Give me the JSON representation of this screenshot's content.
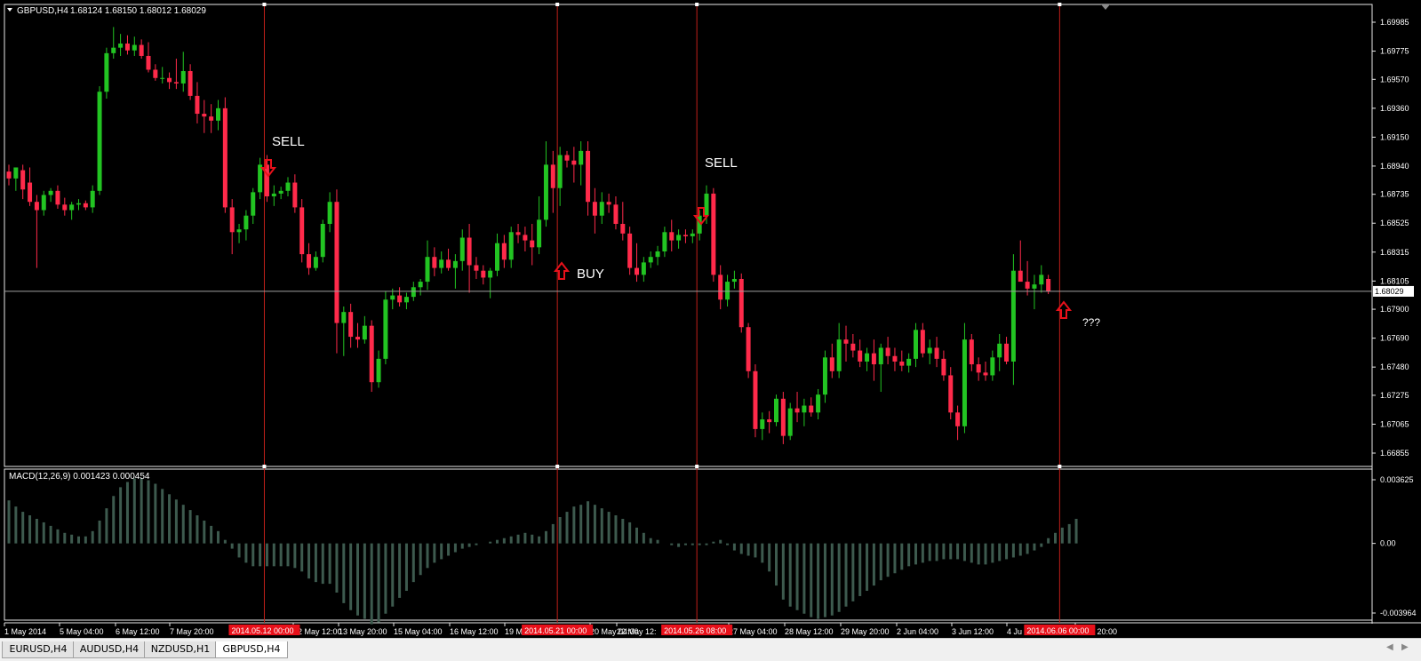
{
  "window": {
    "symbol_label": "GBPUSD,H4",
    "ohlc_text": "1.68124 1.68150 1.68012 1.68029",
    "current_price_label": "1.68029"
  },
  "price_axis_labels": [
    "1.69985",
    "1.69775",
    "1.69570",
    "1.69360",
    "1.69150",
    "1.68940",
    "1.68735",
    "1.68525",
    "1.68315",
    "1.68105",
    "1.67900",
    "1.67690",
    "1.67480",
    "1.67275",
    "1.67065",
    "1.66855"
  ],
  "macd_axis_labels": [
    "0.003625",
    "0.00",
    "-0.003964"
  ],
  "macd_label": "MACD(12,26,9) 0.001423 0.000454",
  "time_axis_labels": [
    "1 May 2014",
    "5 May 04:00",
    "6 May 12:00",
    "7 May 20:00",
    "12 May 12:00",
    "13 May 20:00",
    "15 May 04:00",
    "16 May 12:00",
    "19 M",
    "20 May 04:00",
    "22 May 12:",
    "27 May 04:00",
    "28 May 12:00",
    "29 May 20:00",
    "2 Jun 04:00",
    "3 Jun 12:00",
    "4 Ju",
    "4 Jun 20:00"
  ],
  "markers": [
    {
      "datetime_label": "2014.05.12 00:00",
      "signal": "SELL",
      "direction": "down"
    },
    {
      "datetime_label": "2014.05.21 00:00",
      "signal": "BUY",
      "direction": "up"
    },
    {
      "datetime_label": "2014.05.26 08:00",
      "signal": "SELL",
      "direction": "down"
    },
    {
      "datetime_label": "2014.06.06 00:00",
      "signal": "???",
      "direction": "up"
    }
  ],
  "tabs": [
    {
      "label": "EURUSD,H4",
      "active": false
    },
    {
      "label": "AUDUSD,H4",
      "active": false
    },
    {
      "label": "NZDUSD,H1",
      "active": false
    },
    {
      "label": "GBPUSD,H4",
      "active": true
    }
  ],
  "colors": {
    "bull": "#22c422",
    "bear": "#ff2a4a",
    "marker_line": "#c0201a",
    "grid_text": "#ffffff",
    "macd": "#3d5a4e",
    "bid_line": "#a0a0a0",
    "arrow": "#e8101a"
  },
  "chart_data": {
    "type": "candlestick",
    "symbol": "GBPUSD",
    "timeframe": "H4",
    "price_range": [
      1.66855,
      1.69985
    ],
    "candles": [
      {
        "o": 1.689,
        "h": 1.6895,
        "l": 1.688,
        "c": 1.6885
      },
      {
        "o": 1.6885,
        "h": 1.6892,
        "l": 1.6876,
        "c": 1.6893
      },
      {
        "o": 1.6891,
        "h": 1.6895,
        "l": 1.687,
        "c": 1.6877
      },
      {
        "o": 1.6882,
        "h": 1.6893,
        "l": 1.6865,
        "c": 1.6868
      },
      {
        "o": 1.6868,
        "h": 1.6873,
        "l": 1.682,
        "c": 1.6862
      },
      {
        "o": 1.6862,
        "h": 1.6876,
        "l": 1.6858,
        "c": 1.6873
      },
      {
        "o": 1.6873,
        "h": 1.6878,
        "l": 1.6868,
        "c": 1.6876
      },
      {
        "o": 1.6876,
        "h": 1.688,
        "l": 1.6863,
        "c": 1.6866
      },
      {
        "o": 1.6866,
        "h": 1.6871,
        "l": 1.6858,
        "c": 1.6862
      },
      {
        "o": 1.6862,
        "h": 1.6868,
        "l": 1.6855,
        "c": 1.6866
      },
      {
        "o": 1.6866,
        "h": 1.687,
        "l": 1.6862,
        "c": 1.6867
      },
      {
        "o": 1.6867,
        "h": 1.6869,
        "l": 1.6862,
        "c": 1.6864
      },
      {
        "o": 1.6864,
        "h": 1.688,
        "l": 1.686,
        "c": 1.6876
      },
      {
        "o": 1.6876,
        "h": 1.6952,
        "l": 1.6873,
        "c": 1.6948
      },
      {
        "o": 1.6948,
        "h": 1.698,
        "l": 1.6943,
        "c": 1.6976
      },
      {
        "o": 1.6976,
        "h": 1.6995,
        "l": 1.6972,
        "c": 1.698
      },
      {
        "o": 1.698,
        "h": 1.699,
        "l": 1.6974,
        "c": 1.6983
      },
      {
        "o": 1.6983,
        "h": 1.6989,
        "l": 1.6975,
        "c": 1.6978
      },
      {
        "o": 1.6978,
        "h": 1.6988,
        "l": 1.6974,
        "c": 1.6982
      },
      {
        "o": 1.6982,
        "h": 1.6986,
        "l": 1.6972,
        "c": 1.6974
      },
      {
        "o": 1.6974,
        "h": 1.6984,
        "l": 1.6962,
        "c": 1.6964
      },
      {
        "o": 1.6964,
        "h": 1.6968,
        "l": 1.6956,
        "c": 1.6958
      },
      {
        "o": 1.6958,
        "h": 1.6966,
        "l": 1.6954,
        "c": 1.6958
      },
      {
        "o": 1.6958,
        "h": 1.6962,
        "l": 1.695,
        "c": 1.6955
      },
      {
        "o": 1.6955,
        "h": 1.6972,
        "l": 1.695,
        "c": 1.6954
      },
      {
        "o": 1.6954,
        "h": 1.6977,
        "l": 1.6948,
        "c": 1.6963
      },
      {
        "o": 1.6963,
        "h": 1.6968,
        "l": 1.6942,
        "c": 1.6945
      },
      {
        "o": 1.6945,
        "h": 1.6955,
        "l": 1.6925,
        "c": 1.6932
      },
      {
        "o": 1.6932,
        "h": 1.6942,
        "l": 1.6918,
        "c": 1.693
      },
      {
        "o": 1.693,
        "h": 1.6939,
        "l": 1.6918,
        "c": 1.6927
      },
      {
        "o": 1.6927,
        "h": 1.6942,
        "l": 1.692,
        "c": 1.6936
      },
      {
        "o": 1.6936,
        "h": 1.6944,
        "l": 1.686,
        "c": 1.6864
      },
      {
        "o": 1.6864,
        "h": 1.687,
        "l": 1.683,
        "c": 1.6846
      },
      {
        "o": 1.6846,
        "h": 1.6852,
        "l": 1.6838,
        "c": 1.6848
      },
      {
        "o": 1.6848,
        "h": 1.6862,
        "l": 1.684,
        "c": 1.6858
      },
      {
        "o": 1.6858,
        "h": 1.6878,
        "l": 1.6852,
        "c": 1.6875
      },
      {
        "o": 1.6875,
        "h": 1.69,
        "l": 1.687,
        "c": 1.6895
      },
      {
        "o": 1.6895,
        "h": 1.6902,
        "l": 1.6868,
        "c": 1.6872
      },
      {
        "o": 1.6872,
        "h": 1.688,
        "l": 1.6865,
        "c": 1.6874
      },
      {
        "o": 1.6874,
        "h": 1.6879,
        "l": 1.687,
        "c": 1.6876
      },
      {
        "o": 1.6876,
        "h": 1.6886,
        "l": 1.6872,
        "c": 1.6882
      },
      {
        "o": 1.6882,
        "h": 1.6888,
        "l": 1.686,
        "c": 1.6864
      },
      {
        "o": 1.6864,
        "h": 1.687,
        "l": 1.6824,
        "c": 1.683
      },
      {
        "o": 1.683,
        "h": 1.6838,
        "l": 1.6815,
        "c": 1.682
      },
      {
        "o": 1.682,
        "h": 1.6832,
        "l": 1.6818,
        "c": 1.6828
      },
      {
        "o": 1.6828,
        "h": 1.6855,
        "l": 1.6824,
        "c": 1.6852
      },
      {
        "o": 1.6852,
        "h": 1.6875,
        "l": 1.6846,
        "c": 1.6868
      },
      {
        "o": 1.6868,
        "h": 1.6877,
        "l": 1.6758,
        "c": 1.678
      },
      {
        "o": 1.678,
        "h": 1.6792,
        "l": 1.6756,
        "c": 1.6788
      },
      {
        "o": 1.6788,
        "h": 1.6794,
        "l": 1.6762,
        "c": 1.677
      },
      {
        "o": 1.677,
        "h": 1.678,
        "l": 1.6762,
        "c": 1.6768
      },
      {
        "o": 1.6768,
        "h": 1.6785,
        "l": 1.6765,
        "c": 1.6778
      },
      {
        "o": 1.6778,
        "h": 1.6782,
        "l": 1.673,
        "c": 1.6737
      },
      {
        "o": 1.6737,
        "h": 1.676,
        "l": 1.6733,
        "c": 1.6754
      },
      {
        "o": 1.6754,
        "h": 1.6803,
        "l": 1.675,
        "c": 1.6797
      },
      {
        "o": 1.6797,
        "h": 1.6805,
        "l": 1.679,
        "c": 1.68
      },
      {
        "o": 1.68,
        "h": 1.6806,
        "l": 1.6792,
        "c": 1.6795
      },
      {
        "o": 1.6795,
        "h": 1.6802,
        "l": 1.679,
        "c": 1.6799
      },
      {
        "o": 1.6799,
        "h": 1.681,
        "l": 1.6796,
        "c": 1.6806
      },
      {
        "o": 1.6806,
        "h": 1.6812,
        "l": 1.68,
        "c": 1.681
      },
      {
        "o": 1.681,
        "h": 1.684,
        "l": 1.6804,
        "c": 1.6828
      },
      {
        "o": 1.6828,
        "h": 1.6835,
        "l": 1.6814,
        "c": 1.682
      },
      {
        "o": 1.682,
        "h": 1.6832,
        "l": 1.6816,
        "c": 1.6826
      },
      {
        "o": 1.6826,
        "h": 1.6834,
        "l": 1.6818,
        "c": 1.682
      },
      {
        "o": 1.682,
        "h": 1.683,
        "l": 1.6805,
        "c": 1.6825
      },
      {
        "o": 1.6825,
        "h": 1.6848,
        "l": 1.6818,
        "c": 1.6842
      },
      {
        "o": 1.6842,
        "h": 1.6852,
        "l": 1.6802,
        "c": 1.6822
      },
      {
        "o": 1.6822,
        "h": 1.6828,
        "l": 1.6812,
        "c": 1.6818
      },
      {
        "o": 1.6818,
        "h": 1.6822,
        "l": 1.6808,
        "c": 1.6813
      },
      {
        "o": 1.6813,
        "h": 1.682,
        "l": 1.6798,
        "c": 1.6818
      },
      {
        "o": 1.6818,
        "h": 1.6845,
        "l": 1.6814,
        "c": 1.6838
      },
      {
        "o": 1.6838,
        "h": 1.6844,
        "l": 1.682,
        "c": 1.6826
      },
      {
        "o": 1.6826,
        "h": 1.685,
        "l": 1.682,
        "c": 1.6846
      },
      {
        "o": 1.6846,
        "h": 1.6852,
        "l": 1.6838,
        "c": 1.6844
      },
      {
        "o": 1.6844,
        "h": 1.685,
        "l": 1.6832,
        "c": 1.684
      },
      {
        "o": 1.684,
        "h": 1.6852,
        "l": 1.6822,
        "c": 1.6835
      },
      {
        "o": 1.6835,
        "h": 1.6872,
        "l": 1.683,
        "c": 1.6855
      },
      {
        "o": 1.6855,
        "h": 1.6912,
        "l": 1.685,
        "c": 1.6895
      },
      {
        "o": 1.6895,
        "h": 1.6905,
        "l": 1.686,
        "c": 1.6878
      },
      {
        "o": 1.6878,
        "h": 1.6908,
        "l": 1.6865,
        "c": 1.6902
      },
      {
        "o": 1.6902,
        "h": 1.6905,
        "l": 1.6893,
        "c": 1.6898
      },
      {
        "o": 1.6898,
        "h": 1.6908,
        "l": 1.6882,
        "c": 1.6895
      },
      {
        "o": 1.6895,
        "h": 1.6912,
        "l": 1.688,
        "c": 1.6905
      },
      {
        "o": 1.6905,
        "h": 1.6912,
        "l": 1.6858,
        "c": 1.6868
      },
      {
        "o": 1.6868,
        "h": 1.6878,
        "l": 1.6845,
        "c": 1.6858
      },
      {
        "o": 1.6858,
        "h": 1.6875,
        "l": 1.6852,
        "c": 1.6868
      },
      {
        "o": 1.6868,
        "h": 1.6874,
        "l": 1.686,
        "c": 1.6866
      },
      {
        "o": 1.6866,
        "h": 1.6872,
        "l": 1.6848,
        "c": 1.6852
      },
      {
        "o": 1.6852,
        "h": 1.6868,
        "l": 1.684,
        "c": 1.6845
      },
      {
        "o": 1.6845,
        "h": 1.685,
        "l": 1.6815,
        "c": 1.682
      },
      {
        "o": 1.682,
        "h": 1.6838,
        "l": 1.681,
        "c": 1.6815
      },
      {
        "o": 1.6815,
        "h": 1.6828,
        "l": 1.681,
        "c": 1.6824
      },
      {
        "o": 1.6824,
        "h": 1.6832,
        "l": 1.682,
        "c": 1.6828
      },
      {
        "o": 1.6828,
        "h": 1.6836,
        "l": 1.6822,
        "c": 1.6832
      },
      {
        "o": 1.6832,
        "h": 1.685,
        "l": 1.6828,
        "c": 1.6846
      },
      {
        "o": 1.6846,
        "h": 1.6855,
        "l": 1.6832,
        "c": 1.684
      },
      {
        "o": 1.684,
        "h": 1.6848,
        "l": 1.6834,
        "c": 1.6844
      },
      {
        "o": 1.6844,
        "h": 1.6848,
        "l": 1.6838,
        "c": 1.6843
      },
      {
        "o": 1.6843,
        "h": 1.6848,
        "l": 1.6838,
        "c": 1.6845
      },
      {
        "o": 1.6845,
        "h": 1.6862,
        "l": 1.684,
        "c": 1.6858
      },
      {
        "o": 1.6858,
        "h": 1.688,
        "l": 1.6852,
        "c": 1.6874
      },
      {
        "o": 1.6874,
        "h": 1.6878,
        "l": 1.681,
        "c": 1.6815
      },
      {
        "o": 1.6815,
        "h": 1.6822,
        "l": 1.679,
        "c": 1.6797
      },
      {
        "o": 1.6797,
        "h": 1.6815,
        "l": 1.6792,
        "c": 1.681
      },
      {
        "o": 1.681,
        "h": 1.6818,
        "l": 1.6805,
        "c": 1.6812
      },
      {
        "o": 1.6812,
        "h": 1.6816,
        "l": 1.6773,
        "c": 1.6777
      },
      {
        "o": 1.6777,
        "h": 1.678,
        "l": 1.674,
        "c": 1.6745
      },
      {
        "o": 1.6745,
        "h": 1.675,
        "l": 1.6697,
        "c": 1.6703
      },
      {
        "o": 1.6703,
        "h": 1.6715,
        "l": 1.6695,
        "c": 1.671
      },
      {
        "o": 1.671,
        "h": 1.6716,
        "l": 1.67,
        "c": 1.6708
      },
      {
        "o": 1.6708,
        "h": 1.6728,
        "l": 1.6705,
        "c": 1.6725
      },
      {
        "o": 1.6725,
        "h": 1.673,
        "l": 1.6692,
        "c": 1.6698
      },
      {
        "o": 1.6698,
        "h": 1.6722,
        "l": 1.6695,
        "c": 1.6718
      },
      {
        "o": 1.6718,
        "h": 1.673,
        "l": 1.6708,
        "c": 1.6715
      },
      {
        "o": 1.6715,
        "h": 1.6725,
        "l": 1.6705,
        "c": 1.672
      },
      {
        "o": 1.672,
        "h": 1.6726,
        "l": 1.6712,
        "c": 1.6715
      },
      {
        "o": 1.6715,
        "h": 1.6732,
        "l": 1.671,
        "c": 1.6728
      },
      {
        "o": 1.6728,
        "h": 1.676,
        "l": 1.6722,
        "c": 1.6755
      },
      {
        "o": 1.6755,
        "h": 1.6765,
        "l": 1.674,
        "c": 1.6745
      },
      {
        "o": 1.6745,
        "h": 1.678,
        "l": 1.674,
        "c": 1.6768
      },
      {
        "o": 1.6768,
        "h": 1.6778,
        "l": 1.6752,
        "c": 1.6765
      },
      {
        "o": 1.6765,
        "h": 1.6772,
        "l": 1.6755,
        "c": 1.676
      },
      {
        "o": 1.676,
        "h": 1.6768,
        "l": 1.6748,
        "c": 1.6752
      },
      {
        "o": 1.6752,
        "h": 1.6762,
        "l": 1.6745,
        "c": 1.6758
      },
      {
        "o": 1.6758,
        "h": 1.6768,
        "l": 1.6738,
        "c": 1.675
      },
      {
        "o": 1.675,
        "h": 1.6765,
        "l": 1.673,
        "c": 1.6762
      },
      {
        "o": 1.6762,
        "h": 1.677,
        "l": 1.675,
        "c": 1.6756
      },
      {
        "o": 1.6756,
        "h": 1.6762,
        "l": 1.6745,
        "c": 1.6752
      },
      {
        "o": 1.6752,
        "h": 1.676,
        "l": 1.6745,
        "c": 1.6749
      },
      {
        "o": 1.6749,
        "h": 1.6758,
        "l": 1.6744,
        "c": 1.6754
      },
      {
        "o": 1.6754,
        "h": 1.678,
        "l": 1.6748,
        "c": 1.6775
      },
      {
        "o": 1.6775,
        "h": 1.678,
        "l": 1.6755,
        "c": 1.6758
      },
      {
        "o": 1.6758,
        "h": 1.6768,
        "l": 1.675,
        "c": 1.6762
      },
      {
        "o": 1.6762,
        "h": 1.677,
        "l": 1.6748,
        "c": 1.6754
      },
      {
        "o": 1.6754,
        "h": 1.676,
        "l": 1.6738,
        "c": 1.6742
      },
      {
        "o": 1.6742,
        "h": 1.6748,
        "l": 1.671,
        "c": 1.6715
      },
      {
        "o": 1.6715,
        "h": 1.672,
        "l": 1.6695,
        "c": 1.6705
      },
      {
        "o": 1.6705,
        "h": 1.678,
        "l": 1.67,
        "c": 1.6768
      },
      {
        "o": 1.6768,
        "h": 1.6772,
        "l": 1.6745,
        "c": 1.675
      },
      {
        "o": 1.675,
        "h": 1.6755,
        "l": 1.6738,
        "c": 1.6744
      },
      {
        "o": 1.6744,
        "h": 1.6752,
        "l": 1.6738,
        "c": 1.6742
      },
      {
        "o": 1.6742,
        "h": 1.676,
        "l": 1.6738,
        "c": 1.6755
      },
      {
        "o": 1.6755,
        "h": 1.6772,
        "l": 1.6745,
        "c": 1.6765
      },
      {
        "o": 1.6765,
        "h": 1.677,
        "l": 1.675,
        "c": 1.6752
      },
      {
        "o": 1.6752,
        "h": 1.683,
        "l": 1.6735,
        "c": 1.6818
      },
      {
        "o": 1.6818,
        "h": 1.684,
        "l": 1.6812,
        "c": 1.681
      },
      {
        "o": 1.681,
        "h": 1.6825,
        "l": 1.68,
        "c": 1.6805
      },
      {
        "o": 1.6805,
        "h": 1.6815,
        "l": 1.679,
        "c": 1.6808
      },
      {
        "o": 1.6808,
        "h": 1.6822,
        "l": 1.6802,
        "c": 1.6815
      },
      {
        "o": 1.6812,
        "h": 1.6815,
        "l": 1.6801,
        "c": 1.6803
      }
    ],
    "macd_range": [
      -0.003964,
      0.003625
    ],
    "macd_histogram": [
      0.00245,
      0.0021,
      0.0018,
      0.0016,
      0.0014,
      0.0012,
      0.001,
      0.0008,
      0.0006,
      0.0005,
      0.0004,
      0.0004,
      0.0007,
      0.0013,
      0.002,
      0.0027,
      0.0032,
      0.0035,
      0.0037,
      0.0037,
      0.0036,
      0.0034,
      0.0031,
      0.0028,
      0.0025,
      0.0022,
      0.0019,
      0.0016,
      0.0013,
      0.001,
      0.0007,
      0.0002,
      -0.0003,
      -0.0008,
      -0.0011,
      -0.0013,
      -0.0013,
      -0.0013,
      -0.0013,
      -0.0013,
      -0.0013,
      -0.0014,
      -0.0016,
      -0.002,
      -0.0022,
      -0.0023,
      -0.0023,
      -0.0028,
      -0.0034,
      -0.0038,
      -0.0041,
      -0.0043,
      -0.0046,
      -0.0045,
      -0.004,
      -0.0036,
      -0.0031,
      -0.0027,
      -0.0022,
      -0.0018,
      -0.0014,
      -0.0011,
      -0.0009,
      -0.0007,
      -0.0005,
      -0.0003,
      -0.0002,
      -0.0001,
      0.0,
      0.0001,
      0.0002,
      0.0003,
      0.0004,
      0.0005,
      0.0006,
      0.0005,
      0.0004,
      0.0007,
      0.0011,
      0.0015,
      0.0018,
      0.0021,
      0.0022,
      0.0024,
      0.0022,
      0.002,
      0.0018,
      0.0016,
      0.0014,
      0.0012,
      0.0009,
      0.0006,
      0.0003,
      0.0002,
      0.0,
      -0.0001,
      -0.0002,
      -0.0001,
      -0.0001,
      -0.0001,
      -0.0001,
      0.0001,
      0.0002,
      -0.0001,
      -0.0004,
      -0.0006,
      -0.0007,
      -0.0008,
      -0.0011,
      -0.0016,
      -0.0024,
      -0.0032,
      -0.0036,
      -0.0038,
      -0.004,
      -0.0042,
      -0.0043,
      -0.0042,
      -0.0041,
      -0.0039,
      -0.0036,
      -0.0033,
      -0.003,
      -0.0027,
      -0.0024,
      -0.0021,
      -0.0019,
      -0.0017,
      -0.0015,
      -0.0013,
      -0.0012,
      -0.0011,
      -0.001,
      -0.001,
      -0.0009,
      -0.0009,
      -0.0009,
      -0.001,
      -0.0011,
      -0.0012,
      -0.0012,
      -0.0011,
      -0.001,
      -0.0009,
      -0.0008,
      -0.0007,
      -0.0006,
      -0.0004,
      -0.0002,
      0.0003,
      0.0006,
      0.0009,
      0.0011,
      0.0014
    ]
  }
}
